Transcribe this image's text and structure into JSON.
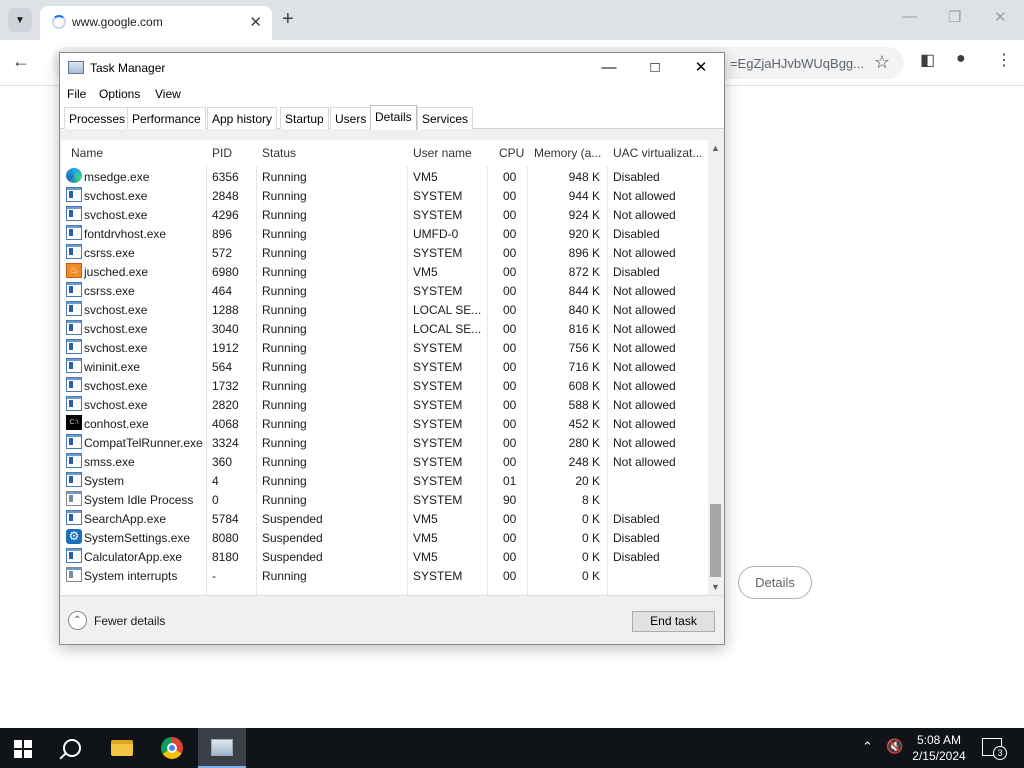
{
  "browser": {
    "tab_title": "www.google.com",
    "tab_close": "✕",
    "new_tab": "+",
    "url_fragment": "=EgZjaHJvbWUqBgg...",
    "details_button": "Details"
  },
  "taskmanager": {
    "title": "Task Manager",
    "menu": [
      "File",
      "Options",
      "View"
    ],
    "tabs": [
      "Processes",
      "Performance",
      "App history",
      "Startup",
      "Users",
      "Details",
      "Services"
    ],
    "active_tab": "Details",
    "columns": [
      "Name",
      "PID",
      "Status",
      "User name",
      "CPU",
      "Memory (a...",
      "UAC virtualizat..."
    ],
    "rows": [
      {
        "icon": "edge",
        "name": "msedge.exe",
        "pid": "6356",
        "status": "Running",
        "user": "VM5",
        "cpu": "00",
        "mem": "948 K",
        "uac": "Disabled"
      },
      {
        "icon": "app",
        "name": "svchost.exe",
        "pid": "2848",
        "status": "Running",
        "user": "SYSTEM",
        "cpu": "00",
        "mem": "944 K",
        "uac": "Not allowed"
      },
      {
        "icon": "app",
        "name": "svchost.exe",
        "pid": "4296",
        "status": "Running",
        "user": "SYSTEM",
        "cpu": "00",
        "mem": "924 K",
        "uac": "Not allowed"
      },
      {
        "icon": "app",
        "name": "fontdrvhost.exe",
        "pid": "896",
        "status": "Running",
        "user": "UMFD-0",
        "cpu": "00",
        "mem": "920 K",
        "uac": "Disabled"
      },
      {
        "icon": "app",
        "name": "csrss.exe",
        "pid": "572",
        "status": "Running",
        "user": "SYSTEM",
        "cpu": "00",
        "mem": "896 K",
        "uac": "Not allowed"
      },
      {
        "icon": "java",
        "name": "jusched.exe",
        "pid": "6980",
        "status": "Running",
        "user": "VM5",
        "cpu": "00",
        "mem": "872 K",
        "uac": "Disabled"
      },
      {
        "icon": "app",
        "name": "csrss.exe",
        "pid": "464",
        "status": "Running",
        "user": "SYSTEM",
        "cpu": "00",
        "mem": "844 K",
        "uac": "Not allowed"
      },
      {
        "icon": "app",
        "name": "svchost.exe",
        "pid": "1288",
        "status": "Running",
        "user": "LOCAL SE...",
        "cpu": "00",
        "mem": "840 K",
        "uac": "Not allowed"
      },
      {
        "icon": "app",
        "name": "svchost.exe",
        "pid": "3040",
        "status": "Running",
        "user": "LOCAL SE...",
        "cpu": "00",
        "mem": "816 K",
        "uac": "Not allowed"
      },
      {
        "icon": "app",
        "name": "svchost.exe",
        "pid": "1912",
        "status": "Running",
        "user": "SYSTEM",
        "cpu": "00",
        "mem": "756 K",
        "uac": "Not allowed"
      },
      {
        "icon": "app",
        "name": "wininit.exe",
        "pid": "564",
        "status": "Running",
        "user": "SYSTEM",
        "cpu": "00",
        "mem": "716 K",
        "uac": "Not allowed"
      },
      {
        "icon": "app",
        "name": "svchost.exe",
        "pid": "1732",
        "status": "Running",
        "user": "SYSTEM",
        "cpu": "00",
        "mem": "608 K",
        "uac": "Not allowed"
      },
      {
        "icon": "app",
        "name": "svchost.exe",
        "pid": "2820",
        "status": "Running",
        "user": "SYSTEM",
        "cpu": "00",
        "mem": "588 K",
        "uac": "Not allowed"
      },
      {
        "icon": "cmd",
        "name": "conhost.exe",
        "pid": "4068",
        "status": "Running",
        "user": "SYSTEM",
        "cpu": "00",
        "mem": "452 K",
        "uac": "Not allowed"
      },
      {
        "icon": "app",
        "name": "CompatTelRunner.exe",
        "pid": "3324",
        "status": "Running",
        "user": "SYSTEM",
        "cpu": "00",
        "mem": "280 K",
        "uac": "Not allowed"
      },
      {
        "icon": "app",
        "name": "smss.exe",
        "pid": "360",
        "status": "Running",
        "user": "SYSTEM",
        "cpu": "00",
        "mem": "248 K",
        "uac": "Not allowed"
      },
      {
        "icon": "app",
        "name": "System",
        "pid": "4",
        "status": "Running",
        "user": "SYSTEM",
        "cpu": "01",
        "mem": "20 K",
        "uac": ""
      },
      {
        "icon": "sys",
        "name": "System Idle Process",
        "pid": "0",
        "status": "Running",
        "user": "SYSTEM",
        "cpu": "90",
        "mem": "8 K",
        "uac": ""
      },
      {
        "icon": "app",
        "name": "SearchApp.exe",
        "pid": "5784",
        "status": "Suspended",
        "user": "VM5",
        "cpu": "00",
        "mem": "0 K",
        "uac": "Disabled"
      },
      {
        "icon": "gear",
        "name": "SystemSettings.exe",
        "pid": "8080",
        "status": "Suspended",
        "user": "VM5",
        "cpu": "00",
        "mem": "0 K",
        "uac": "Disabled"
      },
      {
        "icon": "app",
        "name": "CalculatorApp.exe",
        "pid": "8180",
        "status": "Suspended",
        "user": "VM5",
        "cpu": "00",
        "mem": "0 K",
        "uac": "Disabled"
      },
      {
        "icon": "sys",
        "name": "System interrupts",
        "pid": "-",
        "status": "Running",
        "user": "SYSTEM",
        "cpu": "00",
        "mem": "0 K",
        "uac": ""
      }
    ],
    "footer": {
      "fewer_details": "Fewer details",
      "end_task": "End task"
    }
  },
  "taskbar": {
    "time": "5:08 AM",
    "date": "2/15/2024",
    "notification_count": "3",
    "apps": [
      "search-icon",
      "file-explorer-icon",
      "chrome-icon",
      "task-manager-icon"
    ]
  }
}
